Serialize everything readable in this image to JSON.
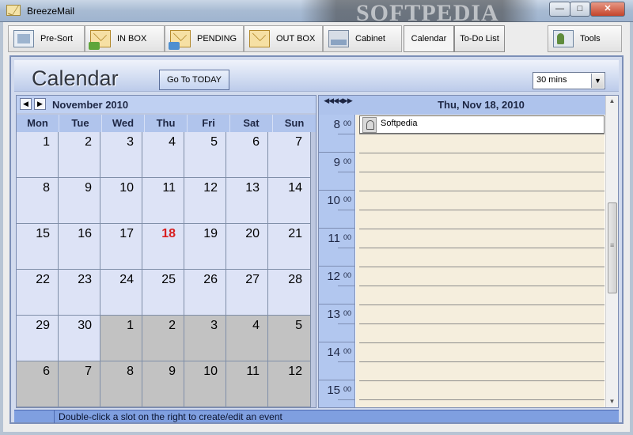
{
  "window": {
    "title": "BreezeMail",
    "watermark": "SOFTPEDIA",
    "minimize": "—",
    "maximize": "□",
    "close": "✕"
  },
  "toolbar": {
    "items": [
      {
        "label": "Pre-Sort",
        "icon": "presort-icon"
      },
      {
        "label": "IN BOX",
        "icon": "inbox-icon"
      },
      {
        "label": "PENDING",
        "icon": "pending-icon"
      },
      {
        "label": "OUT BOX",
        "icon": "outbox-icon"
      },
      {
        "label": "Cabinet",
        "icon": "cabinet-icon"
      },
      {
        "label": "Calendar",
        "active": true
      },
      {
        "label": "To-Do List"
      },
      {
        "label": "Tools",
        "icon": "tools-icon"
      }
    ]
  },
  "calendar": {
    "title": "Calendar",
    "goto_today": "Go To TODAY",
    "interval": "30 mins",
    "interval_arrow": "▼",
    "month": {
      "prev": "◀",
      "next": "▶",
      "label": "November 2010",
      "days_of_week": [
        "Mon",
        "Tue",
        "Wed",
        "Thu",
        "Fri",
        "Sat",
        "Sun"
      ],
      "weeks": [
        [
          "1",
          "2",
          "3",
          "4",
          "5",
          "6",
          "7"
        ],
        [
          "8",
          "9",
          "10",
          "11",
          "12",
          "13",
          "14"
        ],
        [
          "15",
          "16",
          "17",
          "18",
          "19",
          "20",
          "21"
        ],
        [
          "22",
          "23",
          "24",
          "25",
          "26",
          "27",
          "28"
        ],
        [
          "29",
          "30",
          "1",
          "2",
          "3",
          "4",
          "5"
        ],
        [
          "6",
          "7",
          "8",
          "9",
          "10",
          "11",
          "12"
        ]
      ],
      "today": "18"
    },
    "day_view": {
      "nav": "◀◀◀◀▶▶",
      "date": "Thu, Nov 18, 2010",
      "hours": [
        {
          "h": "8",
          "m": "00"
        },
        {
          "h": "9",
          "m": "00"
        },
        {
          "h": "10",
          "m": "00"
        },
        {
          "h": "11",
          "m": "00"
        },
        {
          "h": "12",
          "m": "00"
        },
        {
          "h": "13",
          "m": "00"
        },
        {
          "h": "14",
          "m": "00"
        },
        {
          "h": "15",
          "m": "00"
        }
      ],
      "event": {
        "title": "Softpedia"
      }
    },
    "status": "Double-click a slot on the right to create/edit an event"
  },
  "colors": {
    "accent": "#7f9fe0",
    "today": "#d81f1f",
    "other_month": "#c2c2c2"
  }
}
